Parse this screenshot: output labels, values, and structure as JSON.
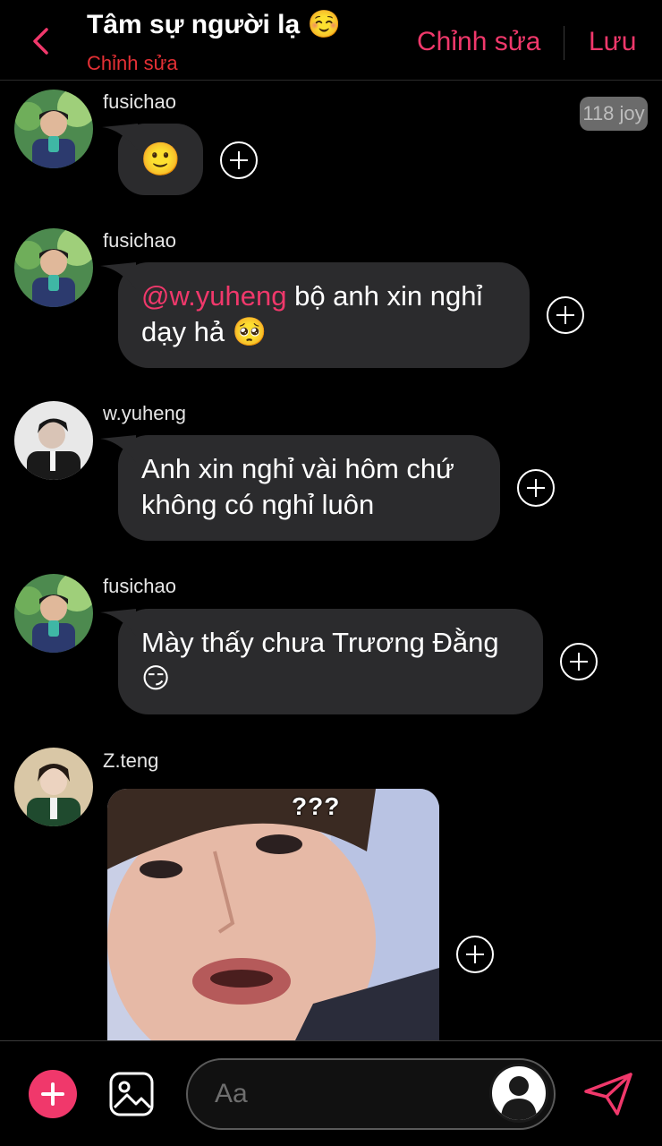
{
  "header": {
    "title": "Tâm sự người lạ ☺️",
    "subtitle": "Chỉnh sửa",
    "edit_label": "Chỉnh sửa",
    "save_label": "Lưu"
  },
  "badge": {
    "joy": "118 joy"
  },
  "messages": [
    {
      "sender": "fusichao",
      "emoji": "🙂"
    },
    {
      "sender": "fusichao",
      "mention": "@w.yuheng",
      "text": " bộ anh xin nghỉ dạy hả 🥺"
    },
    {
      "sender": "w.yuheng",
      "text": "Anh xin nghỉ vài hôm chứ không có nghỉ luôn"
    },
    {
      "sender": "fusichao",
      "text": "Mày thấy chưa Trương Đằng 😏"
    },
    {
      "sender": "Z.teng",
      "sticker_text": "???"
    }
  ],
  "composer": {
    "placeholder": "Aa"
  },
  "icons": {
    "back": "chevron-left-icon",
    "add": "plus-icon",
    "gallery": "image-icon",
    "user": "user-icon",
    "send": "send-icon"
  },
  "colors": {
    "accent": "#f0386b",
    "bubble": "#2b2b2d",
    "background": "#000000"
  }
}
